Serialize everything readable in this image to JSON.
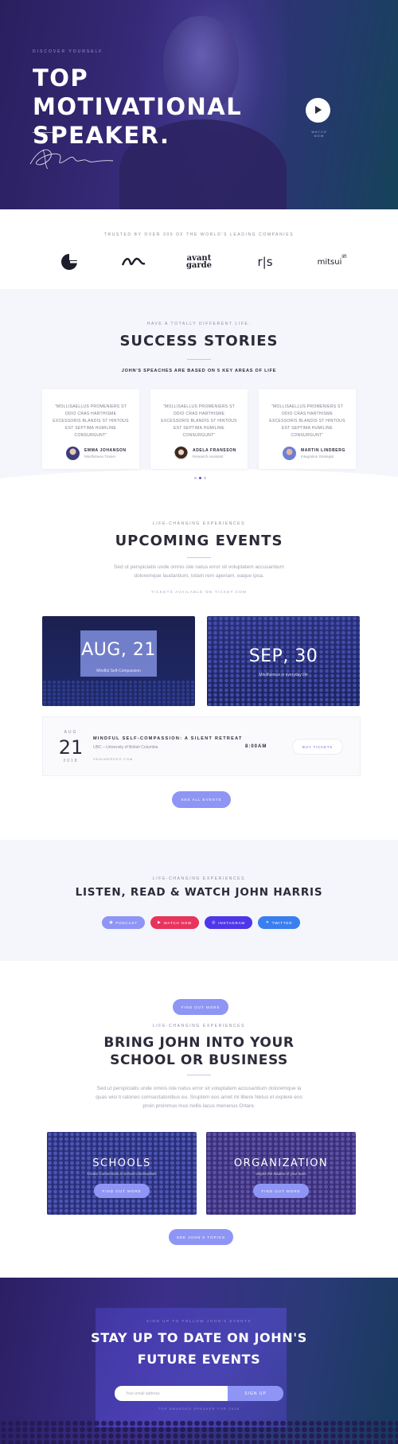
{
  "hero": {
    "eyebrow": "DISCOVER YOURSELF",
    "title": "TOP MOTIVATIONAL SPEAKER.",
    "watch_label": "WATCH NOW"
  },
  "trusted": {
    "text": "TRUSTED BY OVER 300 OF THE WORLD'S LEADING COMPANIES",
    "logos": [
      "e-logo-icon",
      "wave-logo-icon",
      "avant garde",
      "r|s",
      "mitsui"
    ],
    "logo_avant_top": "avant",
    "logo_avant_bottom": "garde",
    "logo_rs": "r|s",
    "logo_mitsui": "mitsui",
    "logo_mitsui_sup": "lift"
  },
  "stories": {
    "eyebrow": "HAVE A TOTALLY DIFFERENT LIFE.",
    "title": "SUCCESS STORIES",
    "subtitle": "JOHN'S SPEACHES ARE BASED ON 5 KEY AREAS OF LIFE",
    "cards": [
      {
        "quote": "\"MOLLISAELLUS PROMENIERS ST ODIO CRAS HARTHISME EXCESSORIS BLANDIS ST HINTOUS EST SEPTIMA HUMILINE CONSURGUNT\"",
        "name": "EMMA JOHANSON",
        "role": "Mindfulness Trainer"
      },
      {
        "quote": "\"MOLLISAELLUS PROMENIERS ST ODIO CRAS HARTHISME EXCESSORIS BLANDIS ST HINTOUS EST SEPTIMA HUMILINE CONSURGUNT\"",
        "name": "ADELA FRANSSON",
        "role": "Research Assistant"
      },
      {
        "quote": "\"MOLLISAELLUS PROMENIERS ST ODIO CRAS HARTHISME EXCESSORIS BLANDIS ST HINTOUS EST SEPTIMA HUMILINE CONSURGUNT\"",
        "name": "MARTIN LINDBERG",
        "role": "Integration Strategist"
      }
    ]
  },
  "events": {
    "eyebrow": "LIFE-CHANGING EXPERIENCES",
    "title": "UPCOMING EVENTS",
    "description": "Sed ut perspiciatis unde omnis iste natus error sit voluptatem accusantium doloremque laudantium, totam rem aperiam, eaque ipsa.",
    "tickets_note": "TICKETS AVAILABLE ON TICKET.COM",
    "cards": [
      {
        "date": "AUG, 21",
        "caption": "Mindful Self-Compassion"
      },
      {
        "date": "SEP, 30",
        "caption": "Mindfulness in everyday life"
      }
    ],
    "row": {
      "month": "AUG",
      "day": "21",
      "year": "2018",
      "title": "MINDFUL SELF-COMPASSION: A SILENT RETREAT",
      "venue": "UBC – University of British Columbia",
      "link": "SEMINERDEP.COM",
      "time": "8:00AM",
      "buy": "BUY TICKETS"
    },
    "see_all": "SEE ALL EVENTS"
  },
  "listen": {
    "eyebrow": "LIFE-CHANGING EXPERIENCES",
    "title": "LISTEN, READ & WATCH JOHN HARRIS",
    "buttons": [
      {
        "label": "PODCAST",
        "icon": "podcast-icon",
        "color": "#8e95f5"
      },
      {
        "label": "WATCH NOW",
        "icon": "youtube-icon",
        "color": "#e8345d"
      },
      {
        "label": "INSTAGRAM",
        "icon": "instagram-icon",
        "color": "#4f36e8"
      },
      {
        "label": "TWITTER",
        "icon": "twitter-icon",
        "color": "#3a7ff0"
      }
    ]
  },
  "bring": {
    "find_out_top": "FIND OUT MORE",
    "eyebrow": "LIFE-CHANGING EXPERIENCES",
    "title": "BRING JOHN INTO YOUR SCHOOL OR BUSINESS",
    "description": "Sed ut perspiciatis unde omnis iste natus error sit voluptatem accusantium doloremque la quas wisi ti ratones comsectatonibus eu. Sruptem eos amet mi libere Netus et explere eos proin proinmus mus nollis lacus menenus Ortare.",
    "cards": [
      {
        "title": "SCHOOLS",
        "subtitle": "Create Connections in School Communities",
        "button": "FIND OUT MORE"
      },
      {
        "title": "ORGANIZATION",
        "subtitle": "Inspire the leaders of your team",
        "button": "FIND OUT MORE"
      }
    ],
    "see_topics": "SEE JOHN'S TOPICS"
  },
  "newsletter": {
    "eyebrow": "SIGN UP TO FOLLOW JOHN'S EVENTS",
    "title": "STAY UP TO DATE ON JOHN'S FUTURE EVENTS",
    "email_placeholder": "Your email address",
    "signup": "SIGN UP",
    "note": "TOP AWARDED SPEAKER FOR 2018"
  },
  "colors": {
    "accent": "#8e95f5",
    "hero_bg": "#3a2d80",
    "youtube": "#e8345d",
    "instagram": "#4f36e8",
    "twitter": "#3a7ff0"
  }
}
